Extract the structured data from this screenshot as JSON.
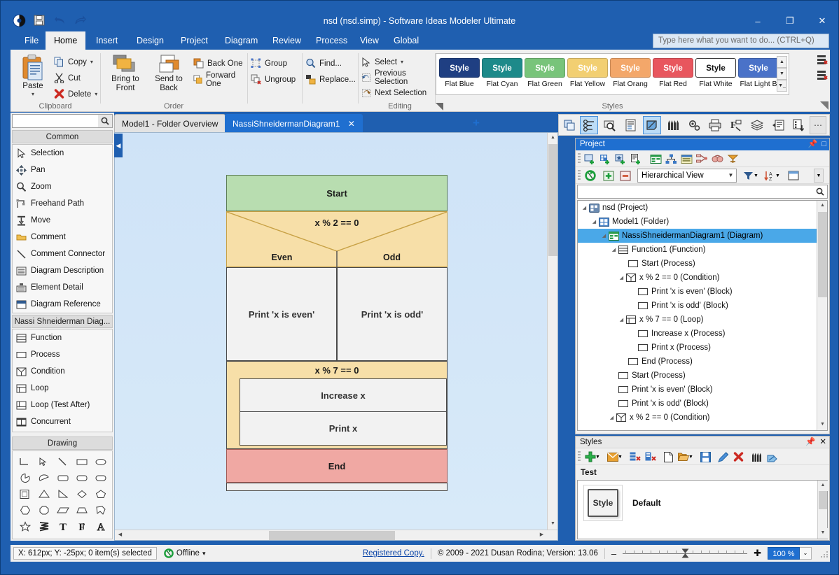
{
  "window": {
    "title": "nsd (nsd.simp)  - Software Ideas Modeler Ultimate",
    "minimize": "–",
    "maximize": "❐",
    "close": "✕"
  },
  "quick_access": [
    {
      "name": "app-logo-icon",
      "glyph": "◐"
    },
    {
      "name": "save-icon",
      "glyph": "💾"
    },
    {
      "name": "undo-icon",
      "glyph": "↶"
    },
    {
      "name": "redo-icon",
      "glyph": "↷"
    }
  ],
  "ribbon_tabs": [
    {
      "label": "File",
      "active": false
    },
    {
      "label": "Home",
      "active": true
    },
    {
      "label": "Insert",
      "active": false
    },
    {
      "label": "Design",
      "active": false
    },
    {
      "label": "Project",
      "active": false
    },
    {
      "label": "Diagram",
      "active": false
    },
    {
      "label": "Review",
      "active": false
    },
    {
      "label": "Process",
      "active": false
    },
    {
      "label": "View",
      "active": false
    },
    {
      "label": "Global",
      "active": false
    }
  ],
  "tell_me": {
    "placeholder": "Type here what you want to do...  (CTRL+Q)"
  },
  "ribbon": {
    "clipboard": {
      "label": "Clipboard",
      "paste": "Paste",
      "copy": "Copy",
      "cut": "Cut",
      "delete": "Delete"
    },
    "order": {
      "label": "Order",
      "bring_to_front_line1": "Bring to",
      "bring_to_front_line2": "Front",
      "send_to_back_line1": "Send to",
      "send_to_back_line2": "Back",
      "back_one": "Back One",
      "forward_one": "Forward One",
      "group": "Group",
      "ungroup": "Ungroup"
    },
    "editing": {
      "label": "Editing",
      "find": "Find...",
      "replace": "Replace...",
      "select": "Select",
      "previous_selection": "Previous Selection",
      "next_selection": "Next Selection"
    },
    "styles": {
      "label": "Styles",
      "chip_label": "Style",
      "items": [
        {
          "name": "Flat Blue",
          "color": "#1f3f82"
        },
        {
          "name": "Flat Cyan",
          "color": "#1d8a8a"
        },
        {
          "name": "Flat Green",
          "color": "#78c47a"
        },
        {
          "name": "Flat Yellow",
          "color": "#f2cf72"
        },
        {
          "name": "Flat Orang",
          "color": "#f3a76a"
        },
        {
          "name": "Flat Red",
          "color": "#e8565e"
        },
        {
          "name": "Flat White",
          "color": "#ffffff"
        },
        {
          "name": "Flat Light B",
          "color": "#4a72c8"
        }
      ]
    }
  },
  "left_panel": {
    "search_value": "",
    "sections": [
      {
        "title": "Common"
      },
      {
        "title": "Nassi Shneiderman Diag..."
      },
      {
        "title": "Drawing"
      }
    ],
    "common_tools": [
      {
        "label": "Selection",
        "icon": "cursor-icon"
      },
      {
        "label": "Pan",
        "icon": "pan-icon"
      },
      {
        "label": "Zoom",
        "icon": "zoom-icon"
      },
      {
        "label": "Freehand Path",
        "icon": "freehand-icon"
      },
      {
        "label": "Move",
        "icon": "move-icon"
      },
      {
        "label": "Comment",
        "icon": "comment-icon"
      },
      {
        "label": "Comment Connector",
        "icon": "connector-icon"
      },
      {
        "label": "Diagram Description",
        "icon": "description-icon"
      },
      {
        "label": "Element Detail",
        "icon": "detail-icon"
      },
      {
        "label": "Diagram Reference",
        "icon": "reference-icon"
      }
    ],
    "nsd_tools": [
      {
        "label": "Function",
        "icon": "function-icon"
      },
      {
        "label": "Process",
        "icon": "process-icon"
      },
      {
        "label": "Condition",
        "icon": "condition-icon"
      },
      {
        "label": "Loop",
        "icon": "loop-icon"
      },
      {
        "label": "Loop (Test After)",
        "icon": "loop-test-after-icon"
      },
      {
        "label": "Concurrent",
        "icon": "concurrent-icon"
      }
    ],
    "drawing_shapes": [
      "corner-line-shape",
      "arrow-shape",
      "line-shape",
      "rectangle-shape",
      "ellipse-shape",
      "pie-shape",
      "half-ellipse-shape",
      "rounded-rect-shape",
      "rounded-rect2-shape",
      "stadium-shape",
      "frame-shape",
      "triangle-shape",
      "right-triangle-shape",
      "diamond-shape",
      "pentagon-shape",
      "hexagon-shape",
      "octagon-shape",
      "parallelogram-shape",
      "trapezoid-shape",
      "arrow-pentagon-shape",
      "star-shape",
      "lightning-shape",
      "text-shape",
      "rich-text-shape",
      "outline-text-shape"
    ]
  },
  "document_tabs": [
    {
      "label": "Model1 - Folder Overview",
      "active": false,
      "closable": false
    },
    {
      "label": "NassiShneidermanDiagram1",
      "active": true,
      "closable": true
    }
  ],
  "add_tab": "+",
  "diagram": {
    "start": "Start",
    "condition_label": "x % 2 == 0",
    "branch_true": "Even",
    "branch_false": "Odd",
    "branch_true_body": "Print 'x is even'",
    "branch_false_body": "Print 'x is odd'",
    "loop_label": "x % 7 == 0",
    "loop_items": [
      "Increase x",
      "Print x"
    ],
    "end": "End",
    "colors": {
      "start_fill": "#b8ddb0",
      "condition_fill": "#f7dfa8",
      "process_fill": "#f2f2f2",
      "end_fill": "#f0a8a3",
      "canvas": "#cfe3f7"
    }
  },
  "view_toolbar": [
    {
      "name": "windows-icon",
      "active": false
    },
    {
      "name": "properties-icon",
      "active": true
    },
    {
      "name": "inspect-icon",
      "active": false
    },
    {
      "name": "documentation-icon",
      "active": false
    },
    {
      "name": "styles-icon",
      "active": true
    },
    {
      "name": "palette-icon",
      "active": false
    },
    {
      "name": "settings-icon",
      "active": false
    },
    {
      "name": "print-icon",
      "active": false
    },
    {
      "name": "format-icon",
      "active": false
    },
    {
      "name": "layers-icon",
      "active": false
    },
    {
      "name": "notes-icon",
      "active": false
    },
    {
      "name": "checklist-icon",
      "active": false
    },
    {
      "name": "more-icon",
      "active": false
    }
  ],
  "project_panel": {
    "title": "Project",
    "pin": "📌",
    "close": "□",
    "view_mode": "Hierarchical View",
    "search_value": "",
    "toolbar_row1": [
      "new-diagram-icon",
      "new-model-icon",
      "new-element-icon",
      "new-document-icon",
      "diagram-list-icon",
      "hierarchy-icon",
      "matrix-icon",
      "relations-icon",
      "comments-icon",
      "tags-icon"
    ],
    "toolbar_row2": [
      "refresh-icon",
      "expand-all-icon",
      "collapse-all-icon"
    ],
    "filter_icon": "filter-icon",
    "sort_icon": "sort-az-icon",
    "layout_icon": "layout-icon",
    "tree": [
      {
        "label": "nsd (Project)",
        "depth": 0,
        "expander": "◢",
        "icon": "project-icon",
        "selected": false
      },
      {
        "label": "Model1 (Folder)",
        "depth": 1,
        "expander": "◢",
        "icon": "folder-icon",
        "selected": false
      },
      {
        "label": "NassiShneidermanDiagram1 (Diagram)",
        "depth": 2,
        "expander": "◢",
        "icon": "diagram-icon",
        "selected": true
      },
      {
        "label": "Function1 (Function)",
        "depth": 3,
        "expander": "◢",
        "icon": "function-icon",
        "selected": false
      },
      {
        "label": "Start (Process)",
        "depth": 4,
        "expander": "",
        "icon": "process-icon",
        "selected": false
      },
      {
        "label": "x % 2 == 0 (Condition)",
        "depth": 4,
        "expander": "◢",
        "icon": "condition-icon",
        "selected": false
      },
      {
        "label": "Print 'x is even' (Block)",
        "depth": 5,
        "expander": "",
        "icon": "process-icon",
        "selected": false
      },
      {
        "label": "Print 'x is odd' (Block)",
        "depth": 5,
        "expander": "",
        "icon": "process-icon",
        "selected": false
      },
      {
        "label": "x % 7 == 0 (Loop)",
        "depth": 4,
        "expander": "◢",
        "icon": "loop-icon",
        "selected": false
      },
      {
        "label": "Increase x (Process)",
        "depth": 5,
        "expander": "",
        "icon": "process-icon",
        "selected": false
      },
      {
        "label": "Print x (Process)",
        "depth": 5,
        "expander": "",
        "icon": "process-icon",
        "selected": false
      },
      {
        "label": "End (Process)",
        "depth": 4,
        "expander": "",
        "icon": "process-icon",
        "selected": false
      },
      {
        "label": "Start (Process)",
        "depth": 3,
        "expander": "",
        "icon": "process-icon",
        "selected": false
      },
      {
        "label": "Print 'x is even' (Block)",
        "depth": 3,
        "expander": "",
        "icon": "process-icon",
        "selected": false
      },
      {
        "label": "Print 'x is odd' (Block)",
        "depth": 3,
        "expander": "",
        "icon": "process-icon",
        "selected": false
      },
      {
        "label": "x % 2 == 0 (Condition)",
        "depth": 3,
        "expander": "◢",
        "icon": "condition-icon",
        "selected": false
      }
    ]
  },
  "styles_panel": {
    "title": "Styles",
    "pin": "📌",
    "close": "✕",
    "category": "Test",
    "toolbar": [
      "add-style-icon",
      "set-style-icon",
      "apply-style-icon",
      "remove-style-icon",
      "new-file-icon",
      "open-file-icon",
      "save-file-icon",
      "edit-icon",
      "delete-icon",
      "palette-set-icon",
      "paint-icon"
    ],
    "items": [
      {
        "thumb_label": "Style",
        "name": "Default"
      }
    ]
  },
  "status_bar": {
    "coords": "X: 612px; Y: -25px; 0 item(s) selected",
    "connection": "Offline",
    "connection_caret": "▾",
    "registered": "Registered Copy.",
    "copyright": "© 2009 - 2021 Dusan Rodina; Version: 13.06",
    "zoom_minus": "–",
    "zoom_plus": "✚",
    "zoom_value": "100 %",
    "zoom_caret": "⌄"
  }
}
